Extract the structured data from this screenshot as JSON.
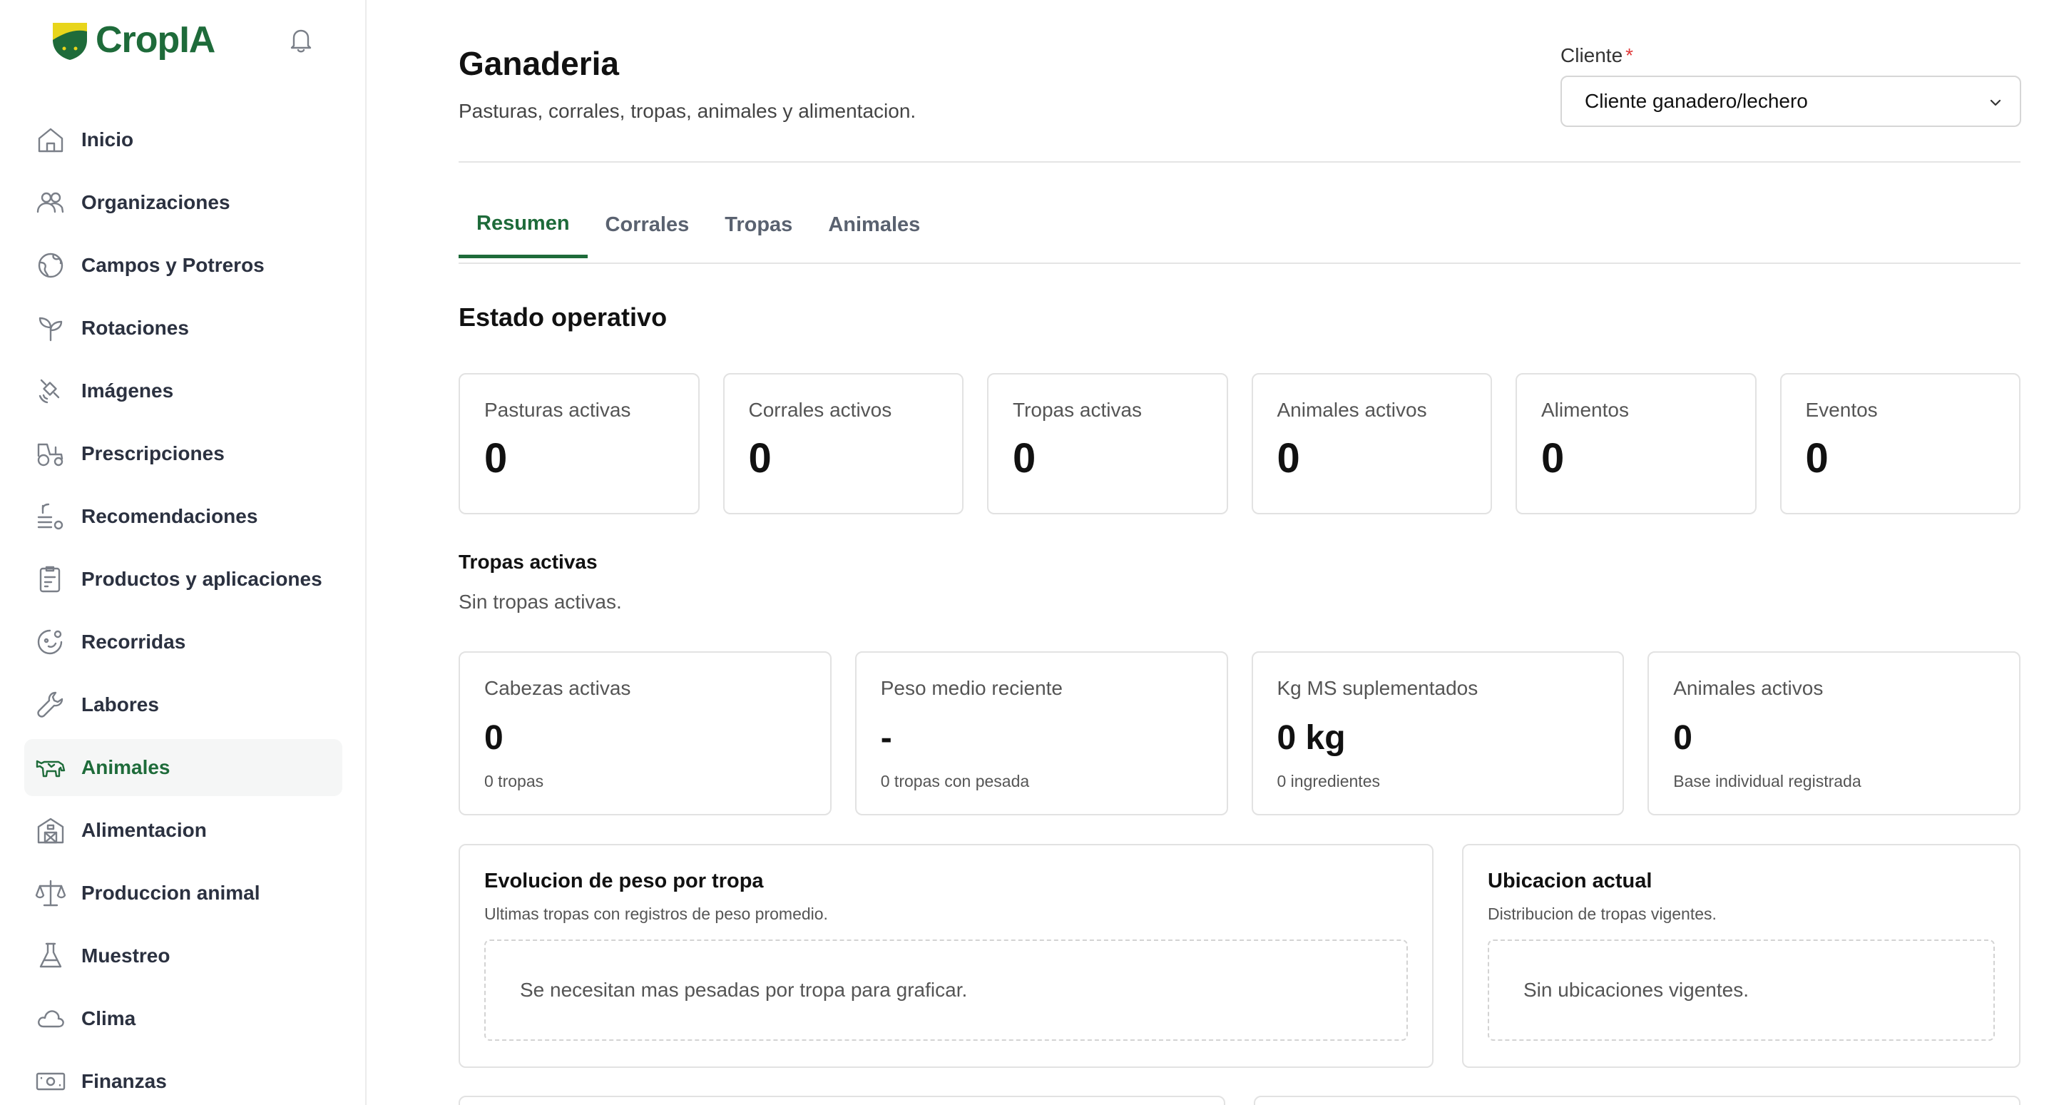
{
  "brand": {
    "name": "CropIA"
  },
  "sidebar": {
    "items": [
      {
        "label": "Inicio",
        "icon": "home-icon"
      },
      {
        "label": "Organizaciones",
        "icon": "users-icon"
      },
      {
        "label": "Campos y Potreros",
        "icon": "earth-icon"
      },
      {
        "label": "Rotaciones",
        "icon": "sprout-icon"
      },
      {
        "label": "Imágenes",
        "icon": "satellite-icon"
      },
      {
        "label": "Prescripciones",
        "icon": "tractor-icon"
      },
      {
        "label": "Recomendaciones",
        "icon": "list-plant-icon"
      },
      {
        "label": "Productos y aplicaciones",
        "icon": "clipboard-icon"
      },
      {
        "label": "Recorridas",
        "icon": "route-icon"
      },
      {
        "label": "Labores",
        "icon": "wrench-icon"
      },
      {
        "label": "Animales",
        "icon": "cow-icon",
        "active": true
      },
      {
        "label": "Alimentacion",
        "icon": "barn-icon"
      },
      {
        "label": "Produccion animal",
        "icon": "scale-icon"
      },
      {
        "label": "Muestreo",
        "icon": "flask-icon"
      },
      {
        "label": "Clima",
        "icon": "cloud-icon"
      },
      {
        "label": "Finanzas",
        "icon": "banknote-icon"
      }
    ]
  },
  "header": {
    "title": "Ganaderia",
    "subtitle": "Pasturas, corrales, tropas, animales y alimentacion.",
    "client_label": "Cliente",
    "client_required": "*",
    "client_value": "Cliente ganadero/lechero"
  },
  "tabs": [
    {
      "label": "Resumen",
      "active": true
    },
    {
      "label": "Corrales"
    },
    {
      "label": "Tropas"
    },
    {
      "label": "Animales"
    }
  ],
  "summary": {
    "section_title": "Estado operativo",
    "stats": [
      {
        "label": "Pasturas activas",
        "value": "0"
      },
      {
        "label": "Corrales activos",
        "value": "0"
      },
      {
        "label": "Tropas activas",
        "value": "0"
      },
      {
        "label": "Animales activos",
        "value": "0"
      },
      {
        "label": "Alimentos",
        "value": "0"
      },
      {
        "label": "Eventos",
        "value": "0"
      }
    ],
    "active_herds_title": "Tropas activas",
    "active_herds_empty": "Sin tropas activas.",
    "kpis": [
      {
        "label": "Cabezas activas",
        "value": "0",
        "note": "0 tropas"
      },
      {
        "label": "Peso medio reciente",
        "value": "-",
        "note": "0 tropas con pesada"
      },
      {
        "label": "Kg MS suplementados",
        "value": "0 kg",
        "note": "0 ingredientes"
      },
      {
        "label": "Animales activos",
        "value": "0",
        "note": "Base individual registrada"
      }
    ],
    "weight_panel": {
      "title": "Evolucion de peso por tropa",
      "subtitle": "Ultimas tropas con registros de peso promedio.",
      "empty": "Se necesitan mas pesadas por tropa para graficar."
    },
    "location_panel": {
      "title": "Ubicacion actual",
      "subtitle": "Distribucion de tropas vigentes.",
      "empty": "Sin ubicaciones vigentes."
    }
  },
  "colors": {
    "accent": "#1e6b3a",
    "brand_yellow": "#e8d51b",
    "required": "#e03b3b"
  }
}
